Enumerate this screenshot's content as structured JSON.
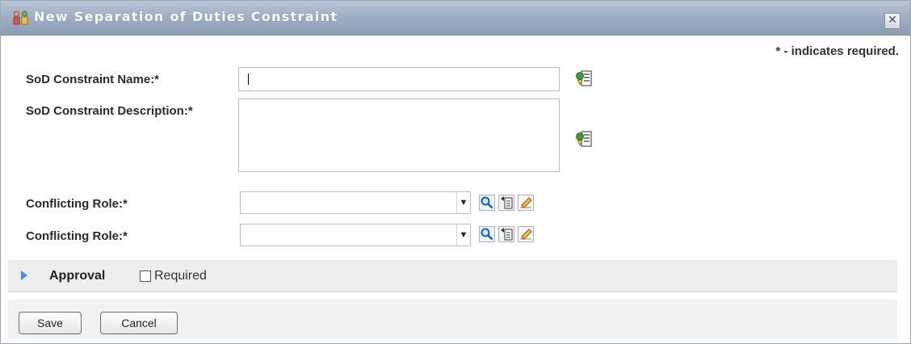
{
  "dialog": {
    "title": "New Separation of Duties Constraint",
    "close_glyph": "✕",
    "required_note": "* - indicates required."
  },
  "form": {
    "name_label": "SoD Constraint Name:*",
    "name_value": "",
    "description_label": "SoD Constraint Description:*",
    "description_value": "",
    "conflicting_role_1_label": "Conflicting Role:*",
    "conflicting_role_1_value": "",
    "conflicting_role_2_label": "Conflicting Role:*",
    "conflicting_role_2_value": ""
  },
  "icons": {
    "title": "roles-icon",
    "language": "multilingual-edit-icon",
    "lookup": "magnifier-icon",
    "history": "history-list-icon",
    "clear": "eraser-icon"
  },
  "approval": {
    "label": "Approval",
    "required_label": "Required",
    "required_checked": false
  },
  "buttons": {
    "save": "Save",
    "cancel": "Cancel"
  },
  "colors": {
    "titlebar": "#9eb0c4",
    "approval_bar": "#eeeeee",
    "expand_triangle": "#4f8fd1"
  }
}
